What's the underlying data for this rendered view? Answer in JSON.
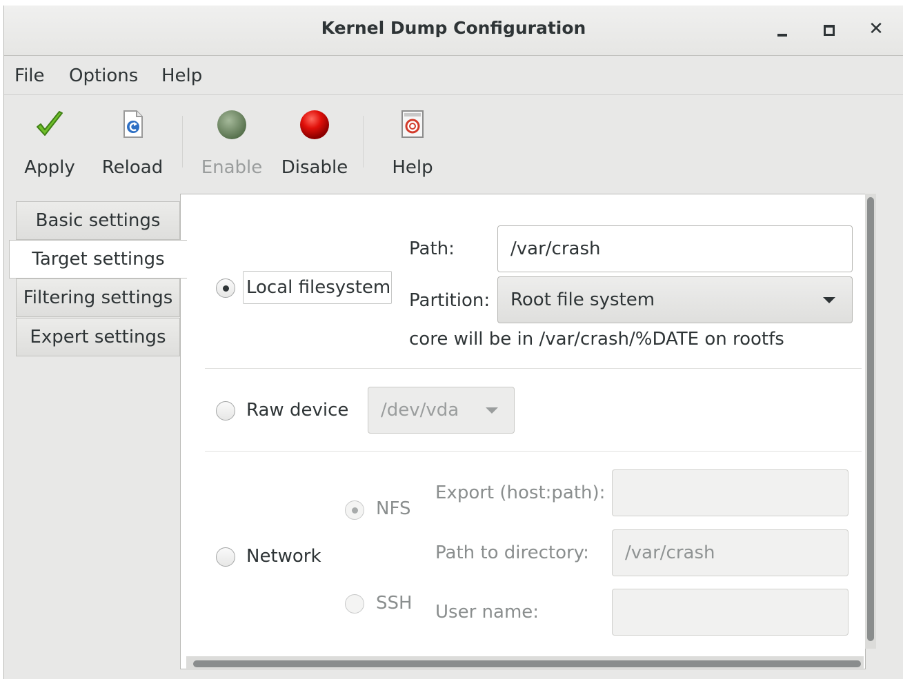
{
  "window": {
    "title": "Kernel Dump Configuration"
  },
  "menu": [
    "File",
    "Options",
    "Help"
  ],
  "toolbar": {
    "apply": "Apply",
    "reload": "Reload",
    "enable": "Enable",
    "disable": "Disable",
    "help": "Help"
  },
  "tabs": [
    "Basic settings",
    "Target settings",
    "Filtering settings",
    "Expert settings"
  ],
  "local": {
    "label": "Local filesystem",
    "path_label": "Path:",
    "path_value": "/var/crash",
    "partition_label": "Partition:",
    "partition_value": "Root file system",
    "info": "core will be in /var/crash/%DATE on rootfs"
  },
  "raw": {
    "label": "Raw device",
    "device_value": "/dev/vda"
  },
  "network": {
    "label": "Network",
    "nfs": "NFS",
    "ssh": "SSH",
    "export_label": "Export (host:path):",
    "export_value": "",
    "dir_label": "Path to directory:",
    "dir_value": "/var/crash",
    "user_label": "User name:",
    "user_value": ""
  }
}
